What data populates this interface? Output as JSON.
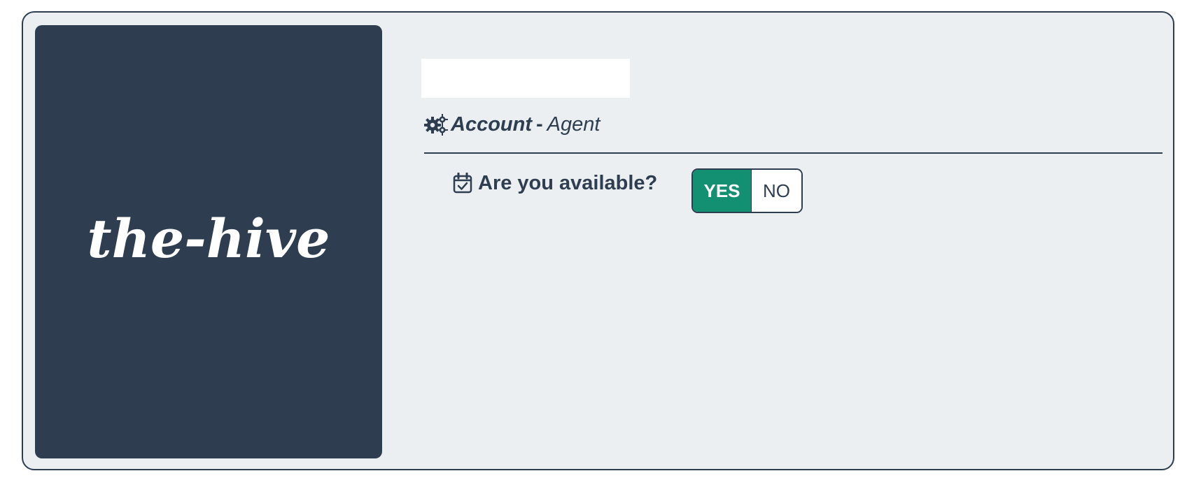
{
  "brand": {
    "logo_text": "the-hive"
  },
  "header": {
    "account_label": "Account",
    "separator": "-",
    "role": "Agent",
    "account_icon": "gears-icon"
  },
  "availability": {
    "question": "Are you available?",
    "icon": "calendar-check-icon",
    "options": [
      "YES",
      "NO"
    ],
    "selected": "YES"
  },
  "colors": {
    "primary": "#2e3e50",
    "background": "#ebeff1",
    "accent": "#138f71"
  }
}
